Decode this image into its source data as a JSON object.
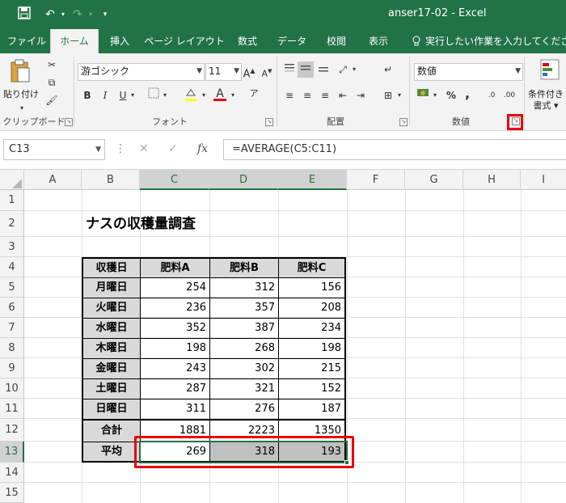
{
  "titlebar": {
    "title": "anser17-02  -  Excel",
    "save_icon": "save-icon",
    "undo_icon": "undo-icon",
    "redo_icon": "redo-icon",
    "customize_icon": "customize-icon"
  },
  "tabs": [
    {
      "label": "ファイル"
    },
    {
      "label": "ホーム"
    },
    {
      "label": "挿入"
    },
    {
      "label": "ページ レイアウト"
    },
    {
      "label": "数式"
    },
    {
      "label": "データ"
    },
    {
      "label": "校閲"
    },
    {
      "label": "表示"
    },
    {
      "label": "実行したい作業を入力してください"
    }
  ],
  "ribbon": {
    "clipboard": {
      "paste_label": "貼り付け",
      "group_label": "クリップボード"
    },
    "font": {
      "name": "游ゴシック",
      "size": "11",
      "group_label": "フォント",
      "bold": "B",
      "italic": "I",
      "underline": "U"
    },
    "alignment": {
      "group_label": "配置"
    },
    "number": {
      "format": "数値",
      "group_label": "数値",
      "percent": "%",
      "comma": ","
    },
    "styles": {
      "cond_label_1": "条件付き",
      "cond_label_2": "書式 ▾"
    }
  },
  "formula_bar": {
    "name_box": "C13",
    "formula": "=AVERAGE(C5:C11)",
    "fx": "fx"
  },
  "columns": [
    "A",
    "B",
    "C",
    "D",
    "E",
    "F",
    "G",
    "H",
    "I"
  ],
  "rows": [
    "1",
    "2",
    "3",
    "4",
    "5",
    "6",
    "7",
    "8",
    "9",
    "10",
    "11",
    "12",
    "13",
    "14",
    "15"
  ],
  "sheet": {
    "title": "ナスの収穫量調査",
    "headers": [
      "収穫日",
      "肥料A",
      "肥料B",
      "肥料C"
    ],
    "data_rows": [
      {
        "label": "月曜日",
        "values": [
          "254",
          "312",
          "156"
        ]
      },
      {
        "label": "火曜日",
        "values": [
          "236",
          "357",
          "208"
        ]
      },
      {
        "label": "水曜日",
        "values": [
          "352",
          "387",
          "234"
        ]
      },
      {
        "label": "木曜日",
        "values": [
          "198",
          "268",
          "198"
        ]
      },
      {
        "label": "金曜日",
        "values": [
          "243",
          "302",
          "215"
        ]
      },
      {
        "label": "土曜日",
        "values": [
          "287",
          "321",
          "152"
        ]
      },
      {
        "label": "日曜日",
        "values": [
          "311",
          "276",
          "187"
        ]
      }
    ],
    "total": {
      "label": "合計",
      "values": [
        "1881",
        "2223",
        "1350"
      ]
    },
    "average": {
      "label": "平均",
      "values": [
        "269",
        "318",
        "193"
      ]
    }
  },
  "colors": {
    "excel_green": "#217346",
    "highlight_red": "#e8000b",
    "header_gray": "#d9d9d9",
    "selection_gray": "#c0c0c0"
  }
}
